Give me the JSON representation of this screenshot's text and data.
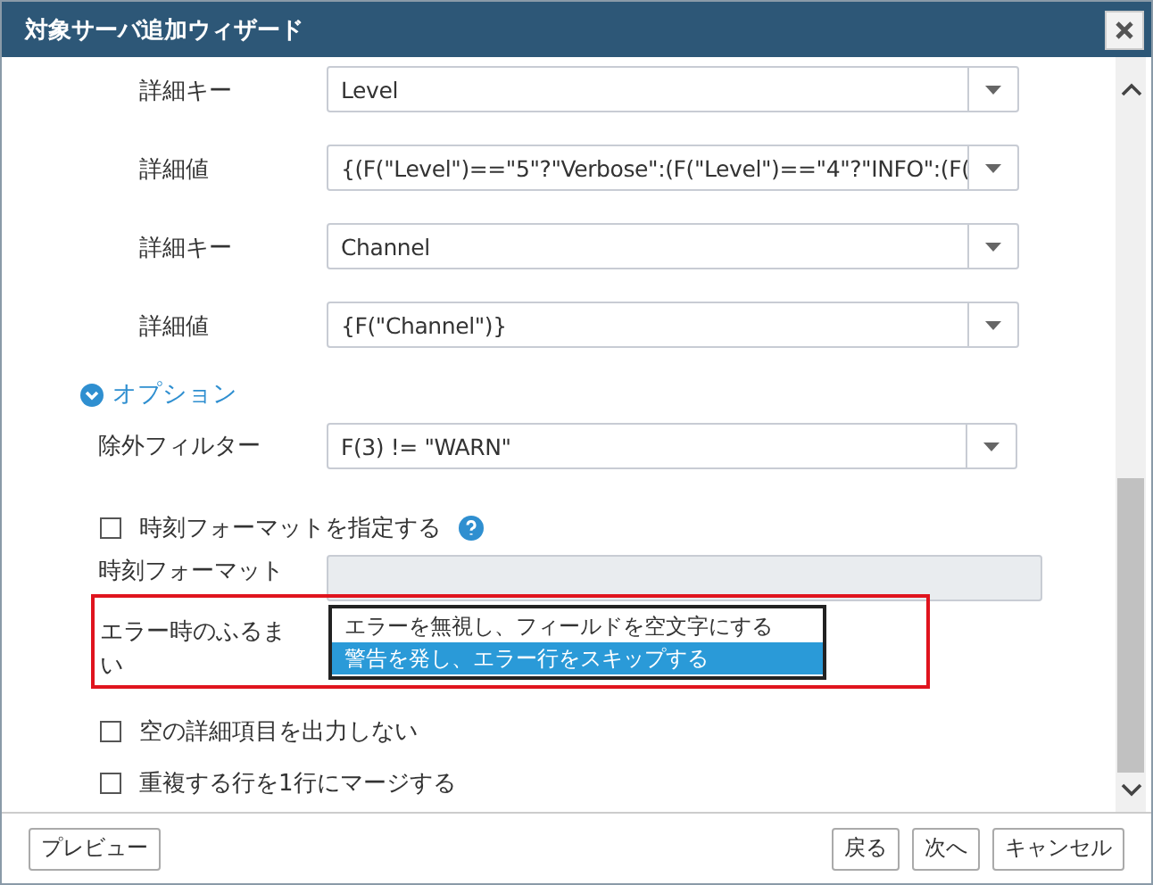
{
  "window": {
    "title": "対象サーバ追加ウィザード"
  },
  "detail_rows": [
    {
      "label": "詳細キー",
      "value": "Level"
    },
    {
      "label": "詳細値",
      "value": "{(F(\"Level\")==\"5\"?\"Verbose\":(F(\"Level\")==\"4\"?\"INFO\":(F("
    },
    {
      "label": "詳細キー",
      "value": "Channel"
    },
    {
      "label": "詳細値",
      "value": "{F(\"Channel\")}"
    }
  ],
  "options_section": {
    "label": "オプション",
    "expanded": true
  },
  "option_items": [
    {
      "kind": "combo",
      "label": "除外フィルター",
      "value": "F(3) != \"WARN\""
    },
    {
      "kind": "checkbox",
      "label": "時刻フォーマットを指定する",
      "checked": false,
      "help": true
    },
    {
      "kind": "text",
      "label": "時刻フォーマット",
      "disabled": true
    },
    {
      "kind": "listbox",
      "label": "エラー時のふるまい",
      "highlighted": true,
      "options": [
        {
          "label": "エラーを無視し、フィールドを空文字にする",
          "selected": false
        },
        {
          "label": "警告を発し、エラー行をスキップする",
          "selected": true
        }
      ]
    },
    {
      "kind": "checkbox",
      "label": "空の詳細項目を出力しない",
      "checked": false
    },
    {
      "kind": "checkbox",
      "label": "重複する行を1行にマージする",
      "checked": false
    }
  ],
  "footer": {
    "left": [
      "プレビュー"
    ],
    "right": [
      "戻る",
      "次へ",
      "キャンセル"
    ]
  }
}
